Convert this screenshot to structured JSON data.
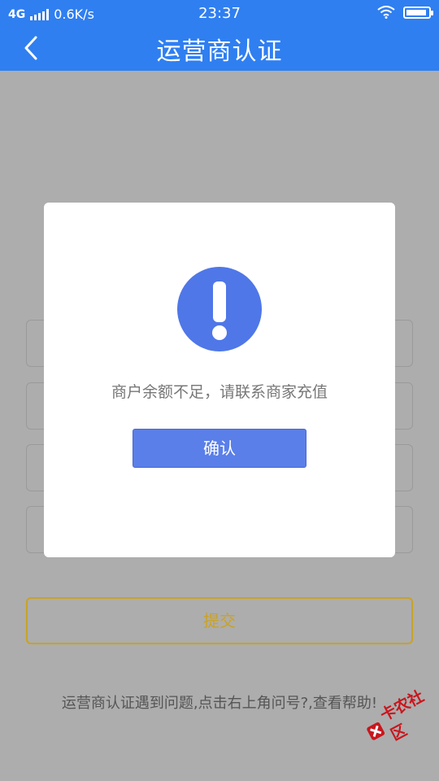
{
  "status_bar": {
    "network": "4G",
    "speed": "0.6K/s",
    "time": "23:37",
    "battery_level": 0.85
  },
  "header": {
    "title": "运营商认证",
    "back_icon": "chevron-left-icon"
  },
  "form": {
    "submit_label": "提交",
    "help_text": "运营商认证遇到问题,点击右上角问号?,查看帮助!"
  },
  "dialog": {
    "icon": "exclamation-circle-icon",
    "message": "商户余额不足，请联系商家充值",
    "confirm_label": "确认"
  },
  "watermark": {
    "text": "卡农社区"
  },
  "colors": {
    "header_bg": "#2f7ff1",
    "overlay_bg": "#adadad",
    "alert_icon": "#4f77e8",
    "confirm_bg": "#5a7fe9",
    "submit_border": "#c9a227",
    "watermark": "#c8161d"
  }
}
